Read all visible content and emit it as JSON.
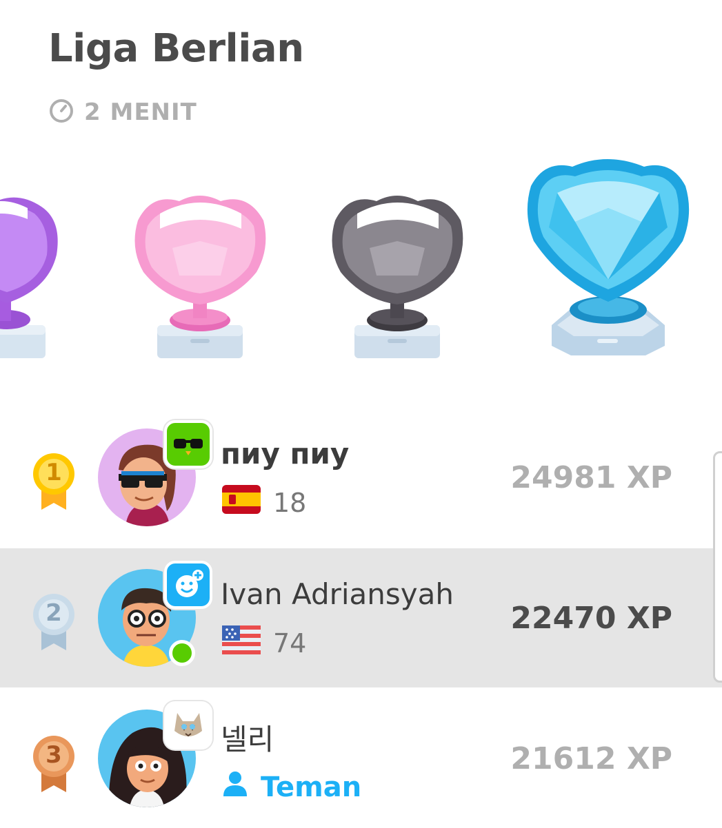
{
  "league": {
    "title": "Liga Berlian",
    "timer_icon": "clock-icon",
    "timer_text": "2 MENIT"
  },
  "trophies": [
    {
      "name": "amethyst-trophy",
      "color": "#b86cf0"
    },
    {
      "name": "pearl-trophy",
      "color": "#f8a4d8"
    },
    {
      "name": "obsidian-trophy",
      "color": "#77727a"
    },
    {
      "name": "diamond-trophy",
      "color": "#2bb7ee"
    }
  ],
  "leaderboard": [
    {
      "rank": "1",
      "medal_color": "#ffc800",
      "name": "пиу пиу",
      "flag": "spain-flag",
      "streak": "18",
      "xp": "24981 XP"
    },
    {
      "rank": "2",
      "medal_color": "#bcd0e0",
      "name": "Ivan Adriansyah",
      "flag": "usa-flag",
      "streak": "74",
      "xp": "22470 XP"
    },
    {
      "rank": "3",
      "medal_color": "#e9975b",
      "name": "넬리",
      "friend_icon": "person-icon",
      "friend_label": "Teman",
      "xp": "21612 XP"
    }
  ],
  "colors": {
    "highlight_row": "#e5e5e5",
    "friend_blue": "#1cb0f6",
    "online_green": "#58cc02"
  }
}
